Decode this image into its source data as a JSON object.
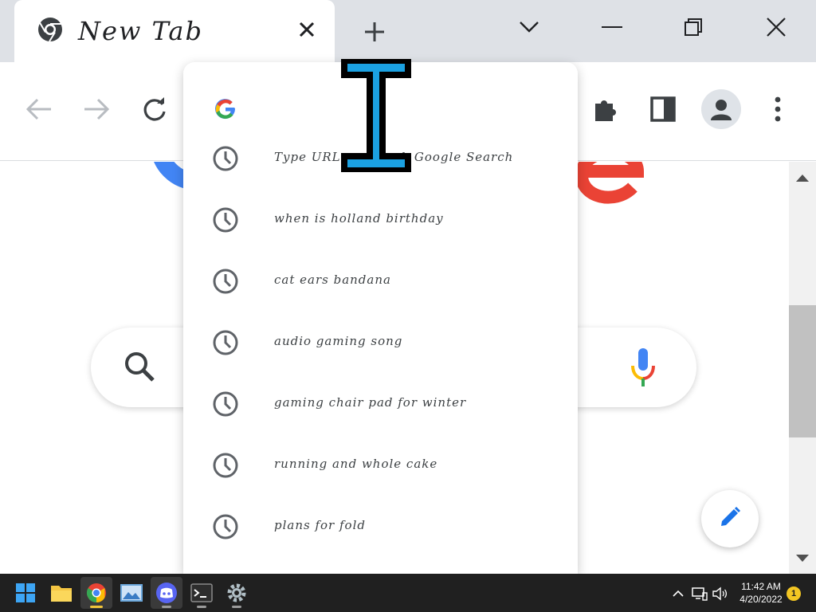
{
  "browser": {
    "tab": {
      "title": "New Tab"
    },
    "window_controls": [
      "tab-search",
      "minimize",
      "restore",
      "close"
    ]
  },
  "toolbar": {
    "buttons": [
      "back",
      "forward",
      "reload",
      "extensions",
      "side-panel",
      "profile",
      "menu"
    ]
  },
  "omnibox_dropdown": {
    "provider_icon": "google-g-icon",
    "suggestions": [
      {
        "icon": "history-clock-icon",
        "text": "Type URL or search Google Search"
      },
      {
        "icon": "history-clock-icon",
        "text": "when is holland birthday"
      },
      {
        "icon": "history-clock-icon",
        "text": "cat ears bandana"
      },
      {
        "icon": "history-clock-icon",
        "text": "audio gaming song"
      },
      {
        "icon": "history-clock-icon",
        "text": "gaming chair pad for winter"
      },
      {
        "icon": "history-clock-icon",
        "text": "running and whole cake"
      },
      {
        "icon": "history-clock-icon",
        "text": "plans for fold"
      }
    ]
  },
  "page": {
    "search_icon": "search-icon",
    "voice_icon": "mic-icon",
    "customize_icon": "pencil-icon"
  },
  "taskbar": {
    "apps": [
      "start",
      "file-explorer",
      "chrome",
      "photos",
      "discord",
      "terminal",
      "settings"
    ],
    "active_app": "chrome",
    "clock": {
      "time": "11:42 AM",
      "date": "4/20/2022"
    },
    "notifications": "1"
  },
  "colors": {
    "tabstrip": "#dee1e6",
    "google_blue": "#4285f4",
    "google_red": "#ea4335",
    "google_yellow": "#fbbc05",
    "google_green": "#34a853",
    "cursor_fill": "#1ba1e2",
    "taskbar": "#202020"
  }
}
